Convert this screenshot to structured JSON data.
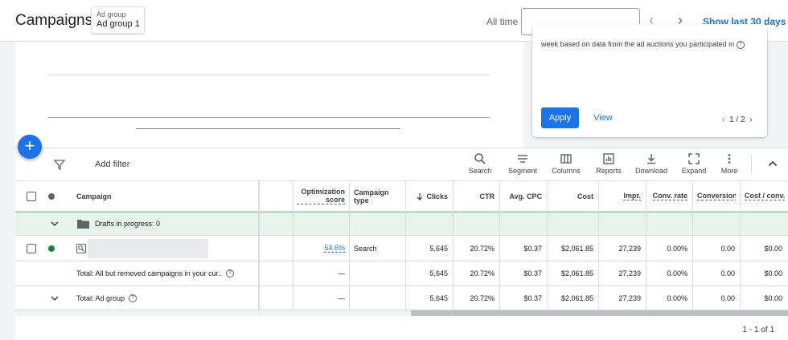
{
  "header": {
    "title": "Campaigns",
    "adgroup_label": "Ad group",
    "adgroup_value": "Ad group 1",
    "date_label": "All time",
    "date_value": "",
    "show_last_link": "Show last 30 days"
  },
  "recommendation": {
    "text": "week based on data from the ad auctions you participated in",
    "apply_label": "Apply",
    "view_label": "View",
    "pager": "1 / 2"
  },
  "toolbar": {
    "add_filter": "Add filter",
    "tools": [
      "Search",
      "Segment",
      "Columns",
      "Reports",
      "Download",
      "Expand",
      "More"
    ]
  },
  "table": {
    "headers": {
      "campaign": "Campaign",
      "optimization_score": "Optimization score",
      "campaign_type": "Campaign type",
      "clicks": "Clicks",
      "ctr": "CTR",
      "avg_cpc": "Avg. CPC",
      "cost": "Cost",
      "impr": "Impr.",
      "conv_rate": "Conv. rate",
      "conversions": "Conversions",
      "cost_conv": "Cost / conv."
    },
    "drafts_row": {
      "label": "Drafts in progress: 0"
    },
    "campaign_row": {
      "name": "",
      "status_color": "#188038",
      "optimization_score": "54.6%",
      "campaign_type": "Search",
      "clicks": "5,645",
      "ctr": "20.72%",
      "avg_cpc": "$0.37",
      "cost": "$2,061.85",
      "impr": "27,239",
      "conv_rate": "0.00%",
      "conversions": "0.00",
      "cost_conv": "$0.00"
    },
    "total_campaigns_row": {
      "label": "Total: All but removed campaigns in your cur...",
      "optimization_score": "—",
      "clicks": "5,645",
      "ctr": "20.72%",
      "avg_cpc": "$0.37",
      "cost": "$2,061.85",
      "impr": "27,239",
      "conv_rate": "0.00%",
      "conversions": "0.00",
      "cost_conv": "$0.00"
    },
    "total_adgroup_row": {
      "label": "Total: Ad group",
      "optimization_score": "—",
      "clicks": "5,645",
      "ctr": "20.72%",
      "avg_cpc": "$0.37",
      "cost": "$2,061.85",
      "impr": "27,239",
      "conv_rate": "0.00%",
      "conversions": "0.00",
      "cost_conv": "$0.00"
    }
  },
  "footer": {
    "row_count": "1 - 1 of 1"
  },
  "colors": {
    "accent": "#1a73e8",
    "drafts_bg": "#e6f4ea",
    "active": "#188038"
  }
}
